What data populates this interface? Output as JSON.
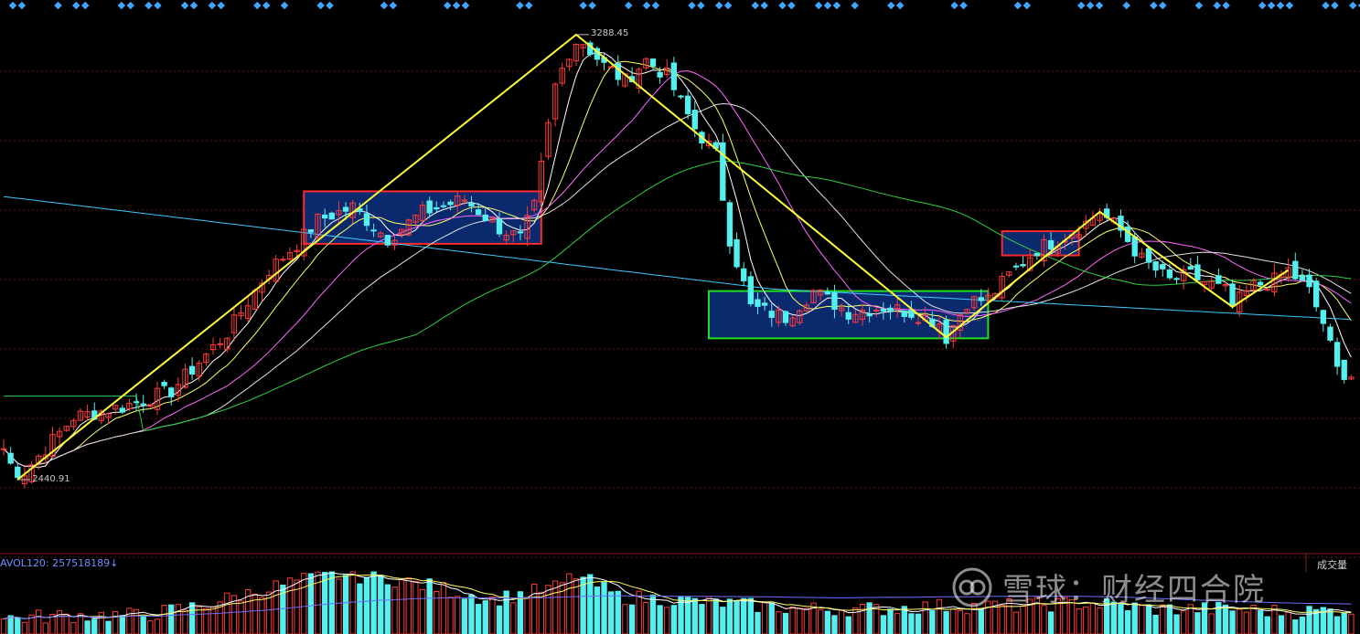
{
  "chart_data": {
    "type": "candlestick",
    "y_range": [
      2300,
      3330
    ],
    "marks": {
      "high": {
        "value": 3288.45,
        "text": "3288.45"
      },
      "low": {
        "value": 2440.91,
        "text": "2440.91"
      }
    },
    "ma_periods": [
      5,
      10,
      20,
      30,
      60,
      250
    ],
    "volume": {
      "label": "AVOL120: 257518189↓",
      "tag": "成交量"
    },
    "colors": {
      "up": "#ff3a3a",
      "down": "#54f0f0",
      "box_fill": "#0b2a6e",
      "box_red": "#ff2a2a",
      "box_green": "#22dd22",
      "trend": "#ffff33",
      "grid": "#6a1414",
      "ma5": "#ffffff",
      "ma10": "#ffff66",
      "ma20": "#ff66ff",
      "ma30": "#e0e0e0",
      "ma60": "#30d040",
      "ma250": "#40c8ff"
    },
    "boxes": [
      {
        "t0": 43,
        "t1": 77,
        "low": 2890,
        "high": 2990,
        "border": "red"
      },
      {
        "t0": 101,
        "t1": 141,
        "low": 2710,
        "high": 2800,
        "border": "green"
      },
      {
        "t0": 143,
        "t1": 154,
        "low": 2868,
        "high": 2914,
        "border": "red"
      }
    ],
    "trend_points": [
      {
        "t": 2,
        "v": 2440.91
      },
      {
        "t": 82,
        "v": 3288.45
      },
      {
        "t": 135,
        "v": 2712
      },
      {
        "t": 157,
        "v": 2951
      },
      {
        "t": 176,
        "v": 2770
      },
      {
        "t": 184,
        "v": 2840
      }
    ],
    "anchors": [
      [
        0,
        2500
      ],
      [
        2,
        2440.91
      ],
      [
        10,
        2560
      ],
      [
        17,
        2580
      ],
      [
        24,
        2610
      ],
      [
        32,
        2720
      ],
      [
        38,
        2840
      ],
      [
        42,
        2890
      ],
      [
        45,
        2935
      ],
      [
        50,
        2960
      ],
      [
        55,
        2900
      ],
      [
        60,
        2950
      ],
      [
        66,
        2975
      ],
      [
        71,
        2920
      ],
      [
        74,
        2900
      ],
      [
        76,
        2960
      ],
      [
        79,
        3190
      ],
      [
        82,
        3288.45
      ],
      [
        86,
        3230
      ],
      [
        89,
        3200
      ],
      [
        92,
        3240
      ],
      [
        95,
        3210
      ],
      [
        99,
        3110
      ],
      [
        102,
        3060
      ],
      [
        104,
        2900
      ],
      [
        107,
        2770
      ],
      [
        112,
        2750
      ],
      [
        116,
        2800
      ],
      [
        121,
        2760
      ],
      [
        126,
        2770
      ],
      [
        130,
        2760
      ],
      [
        134,
        2740
      ],
      [
        135,
        2712
      ],
      [
        138,
        2780
      ],
      [
        141,
        2785
      ],
      [
        144,
        2830
      ],
      [
        148,
        2880
      ],
      [
        152,
        2905
      ],
      [
        155,
        2930
      ],
      [
        157,
        2951
      ],
      [
        160,
        2915
      ],
      [
        163,
        2860
      ],
      [
        167,
        2820
      ],
      [
        170,
        2830
      ],
      [
        175,
        2800
      ],
      [
        176,
        2770
      ],
      [
        179,
        2810
      ],
      [
        182,
        2820
      ],
      [
        184,
        2840
      ],
      [
        187,
        2800
      ],
      [
        189,
        2740
      ],
      [
        191,
        2650
      ],
      [
        193,
        2640
      ]
    ],
    "vol_anchors": [
      [
        0,
        0.25
      ],
      [
        10,
        0.3
      ],
      [
        20,
        0.3
      ],
      [
        28,
        0.45
      ],
      [
        35,
        0.65
      ],
      [
        42,
        0.85
      ],
      [
        48,
        0.95
      ],
      [
        55,
        0.9
      ],
      [
        62,
        0.75
      ],
      [
        70,
        0.55
      ],
      [
        79,
        0.75
      ],
      [
        82,
        0.95
      ],
      [
        88,
        0.6
      ],
      [
        95,
        0.55
      ],
      [
        102,
        0.5
      ],
      [
        108,
        0.45
      ],
      [
        115,
        0.4
      ],
      [
        125,
        0.4
      ],
      [
        135,
        0.45
      ],
      [
        145,
        0.45
      ],
      [
        155,
        0.5
      ],
      [
        165,
        0.4
      ],
      [
        175,
        0.4
      ],
      [
        185,
        0.35
      ],
      [
        193,
        0.4
      ]
    ],
    "n_bars": 194
  },
  "watermark": {
    "text": "雪球：财经四合院",
    "icon": "snowball-logo-icon"
  },
  "top_markers": {
    "color": "#3fa6ff"
  }
}
